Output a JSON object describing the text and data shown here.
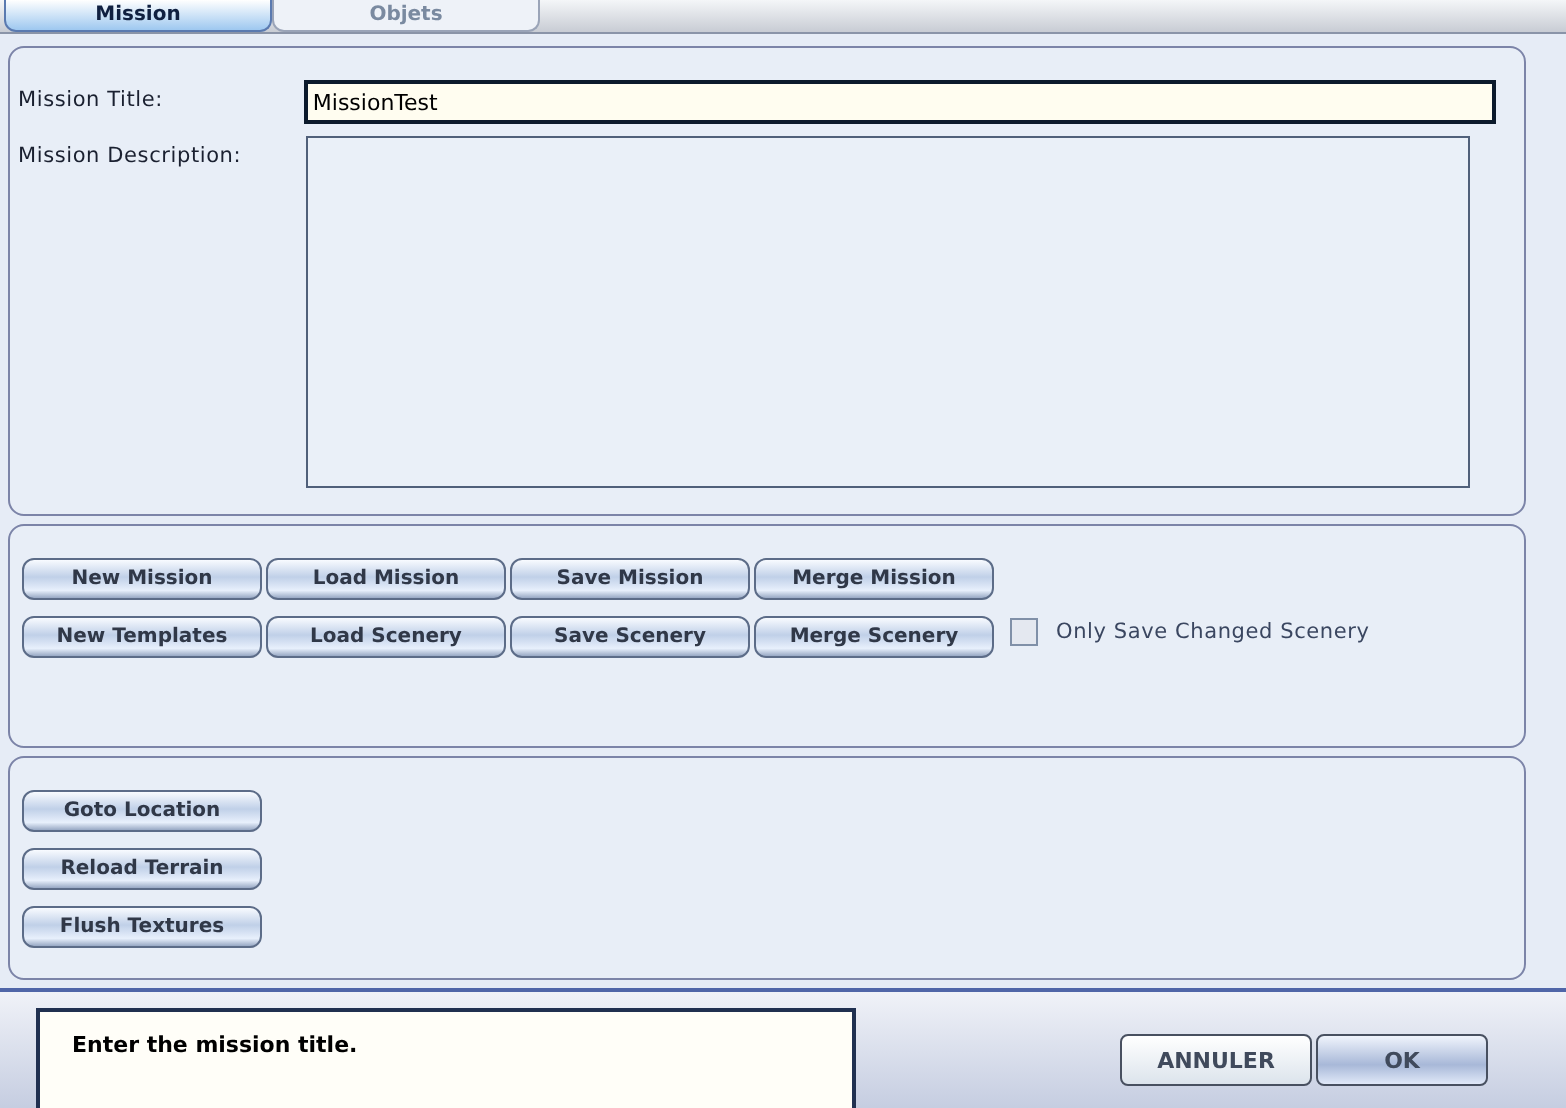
{
  "tabs": [
    {
      "label": "Mission",
      "selected": true
    },
    {
      "label": "Objets",
      "selected": false
    }
  ],
  "mission": {
    "title_label": "Mission Title:",
    "title_value": "MissionTest",
    "description_label": "Mission Description:"
  },
  "file_buttons": [
    [
      "New Mission",
      "Load Mission",
      "Save Mission",
      "Merge Mission"
    ],
    [
      "New Templates",
      "Load Scenery",
      "Save Scenery",
      "Merge Scenery"
    ]
  ],
  "only_save_changed": {
    "label": "Only Save Changed Scenery",
    "checked": false
  },
  "tool_buttons": [
    "Goto Location",
    "Reload Terrain",
    "Flush Textures"
  ],
  "status_text": "Enter the mission title.",
  "dialog_buttons": [
    "ANNULER",
    "OK"
  ]
}
